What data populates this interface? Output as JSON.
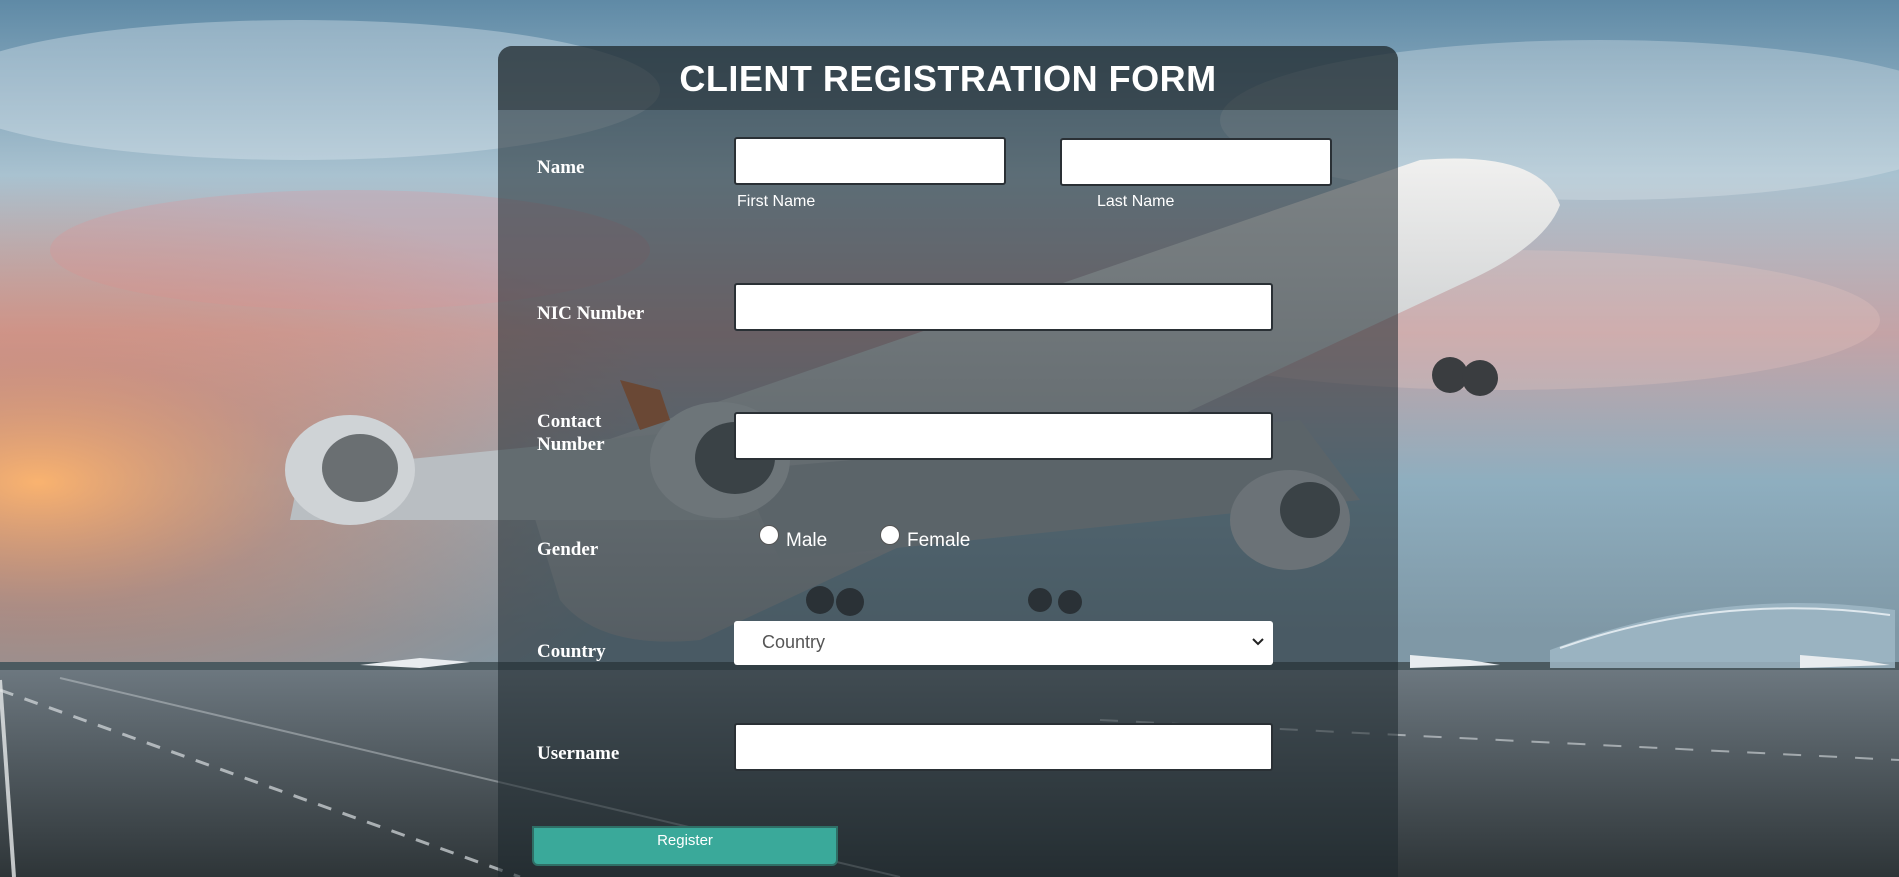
{
  "form": {
    "title": "CLIENT REGISTRATION FORM",
    "register_label": "Register"
  },
  "fields": {
    "name_label": "Name",
    "first_name_sub": "First Name",
    "last_name_sub": "Last Name",
    "nic_label": "NIC Number",
    "contact_label": "Contact Number",
    "gender_label": "Gender",
    "gender_options": [
      "Male",
      "Female"
    ],
    "country_label": "Country",
    "country_selected": "Country",
    "username_label": "Username"
  },
  "colors": {
    "button_accent": "#3aa99a",
    "panel_overlay": "rgba(30, 40, 45, 0.55)"
  },
  "icons": {
    "select_caret": "chevron-down-icon"
  }
}
